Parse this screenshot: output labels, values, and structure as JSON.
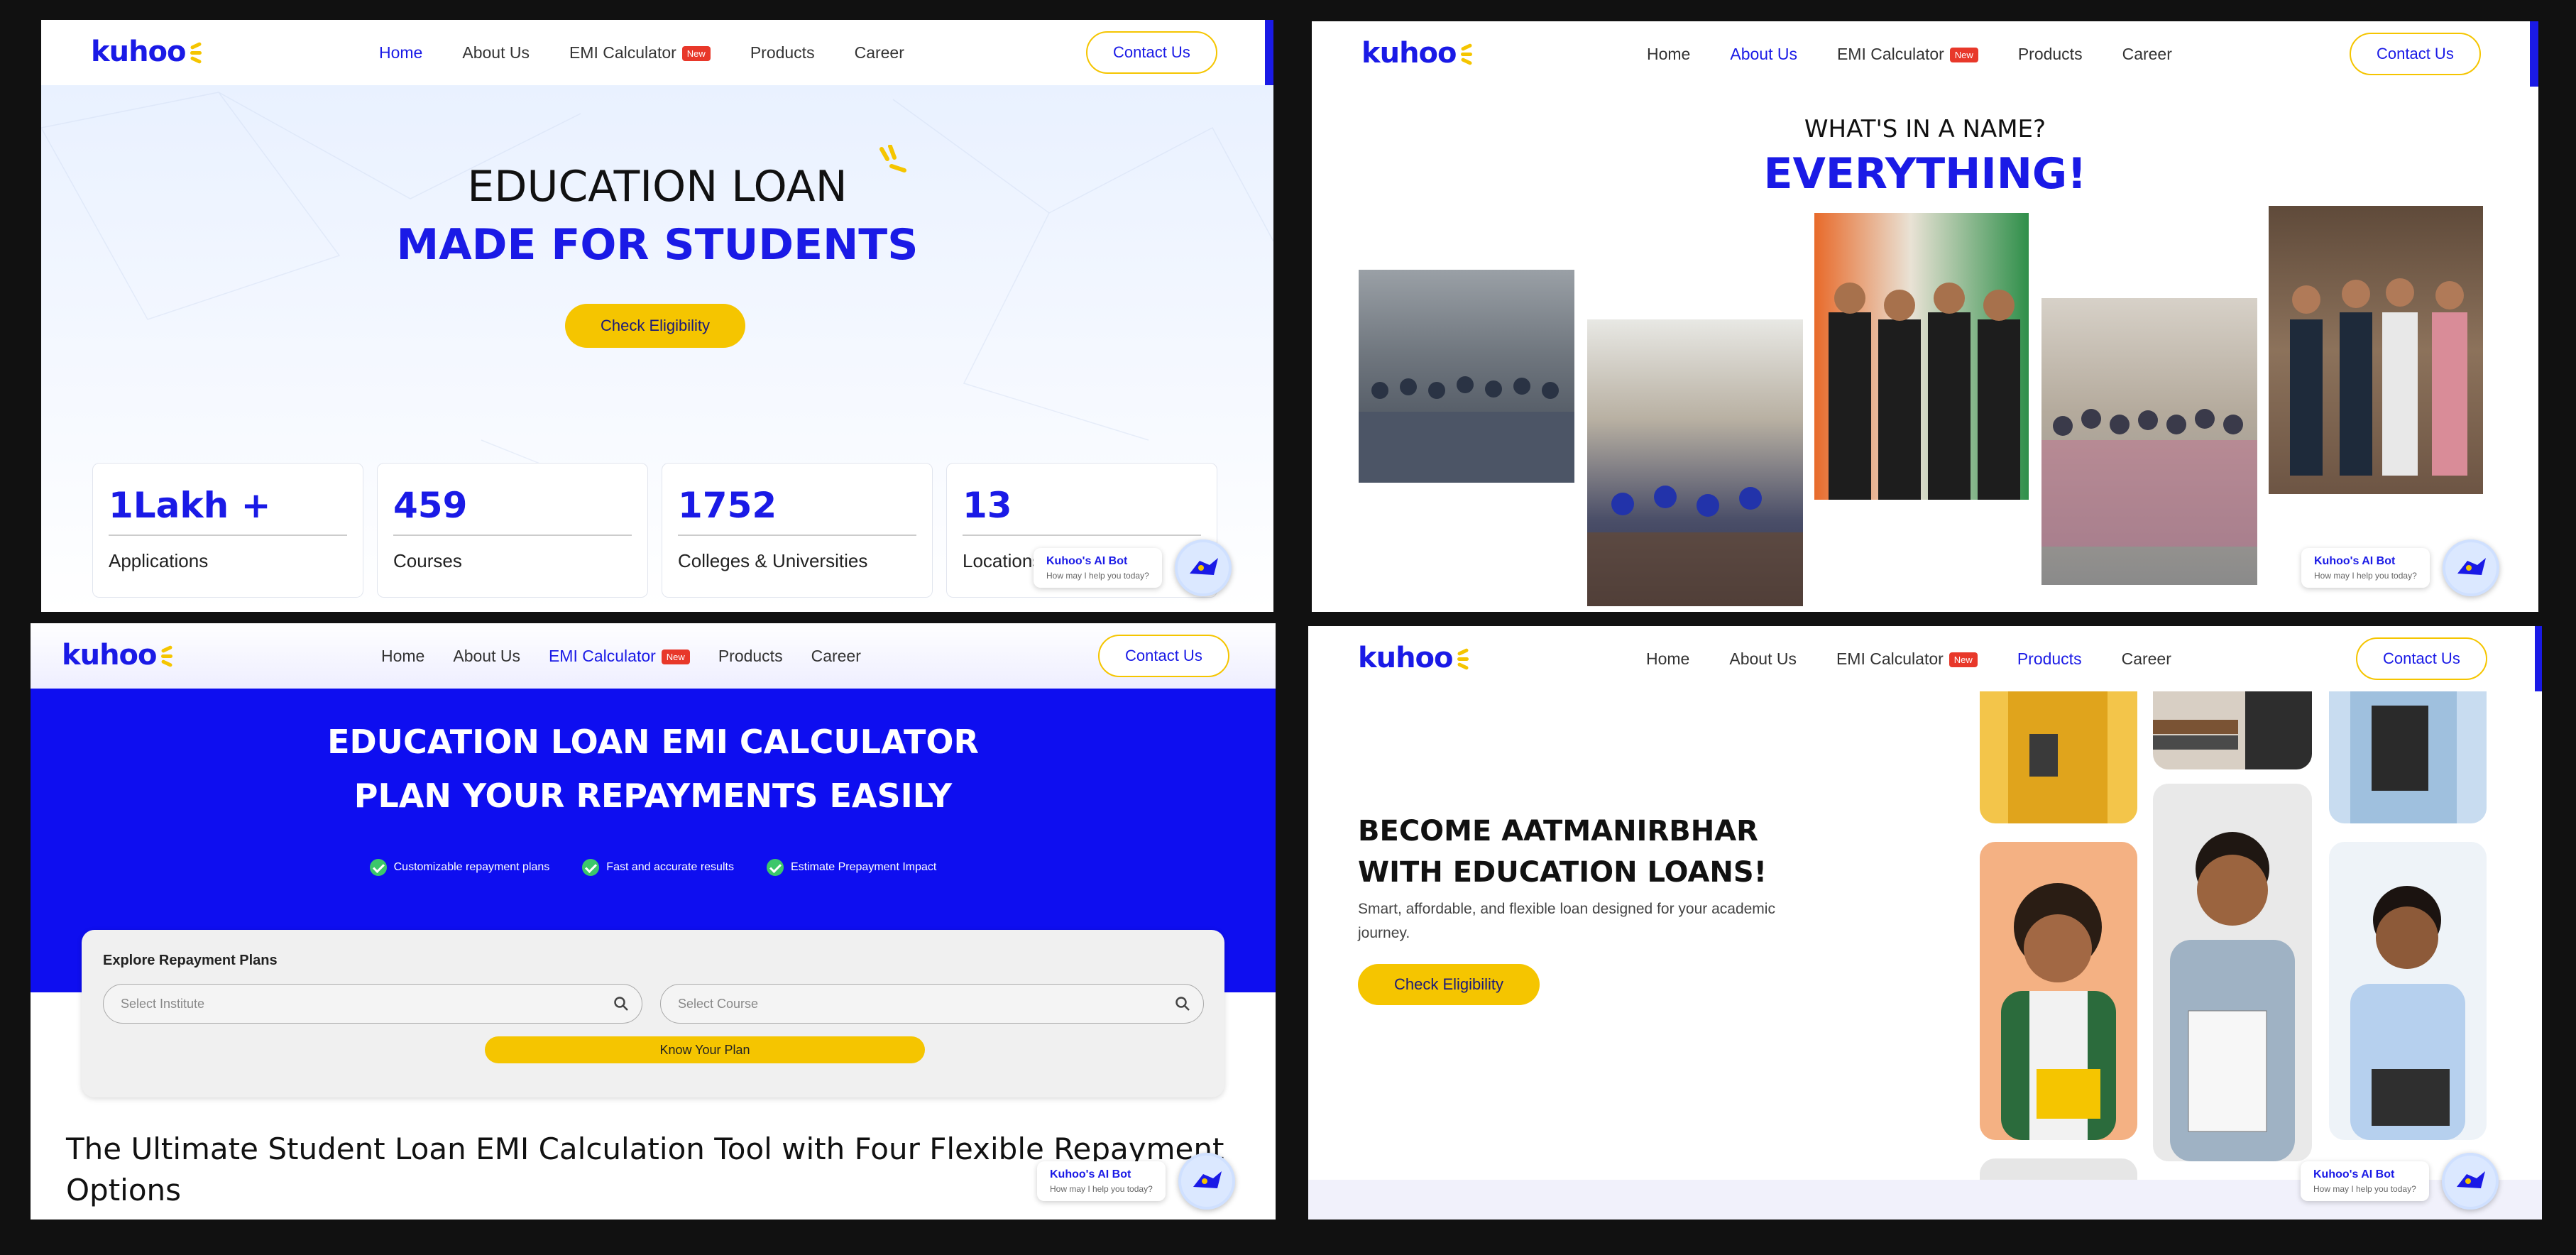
{
  "brand": {
    "logo": "kuhoo",
    "accent": "#1a1ae6",
    "yellow": "#f5c500",
    "new_badge": "#e8382a"
  },
  "nav": {
    "items": [
      "Home",
      "About Us",
      "EMI Calculator",
      "Products",
      "Career"
    ],
    "new_badge": "New",
    "contact": "Contact Us"
  },
  "bot": {
    "title": "Kuhoo's AI Bot",
    "subtitle": "How may I help you today?"
  },
  "home": {
    "active_tab": "Home",
    "headline_1": "EDUCATION LOAN",
    "headline_2": "MADE FOR STUDENTS",
    "cta": "Check Eligibility",
    "stats": [
      {
        "value": "1Lakh +",
        "label": "Applications"
      },
      {
        "value": "459",
        "label": "Courses"
      },
      {
        "value": "1752",
        "label": "Colleges & Universities"
      },
      {
        "value": "13",
        "label": "Locations"
      }
    ]
  },
  "about": {
    "active_tab": "About Us",
    "question": "WHAT'S IN A NAME?",
    "answer": "EVERYTHING!"
  },
  "emi": {
    "active_tab": "EMI Calculator",
    "headline_1": "EDUCATION LOAN EMI CALCULATOR",
    "headline_2": "PLAN YOUR REPAYMENTS EASILY",
    "features": [
      "Customizable repayment plans",
      "Fast and accurate results",
      "Estimate Prepayment Impact"
    ],
    "card_title": "Explore Repayment Plans",
    "institute_placeholder": "Select Institute",
    "course_placeholder": "Select Course",
    "plan_button": "Know Your Plan",
    "section_title": "The Ultimate Student Loan EMI Calculation Tool with Four Flexible Repayment Options"
  },
  "products": {
    "active_tab": "Products",
    "headline_1": "BECOME AATMANIRBHAR",
    "headline_2": "WITH EDUCATION LOANS!",
    "subtitle": "Smart, affordable, and flexible loan designed for your academic journey.",
    "cta": "Check Eligibility"
  }
}
